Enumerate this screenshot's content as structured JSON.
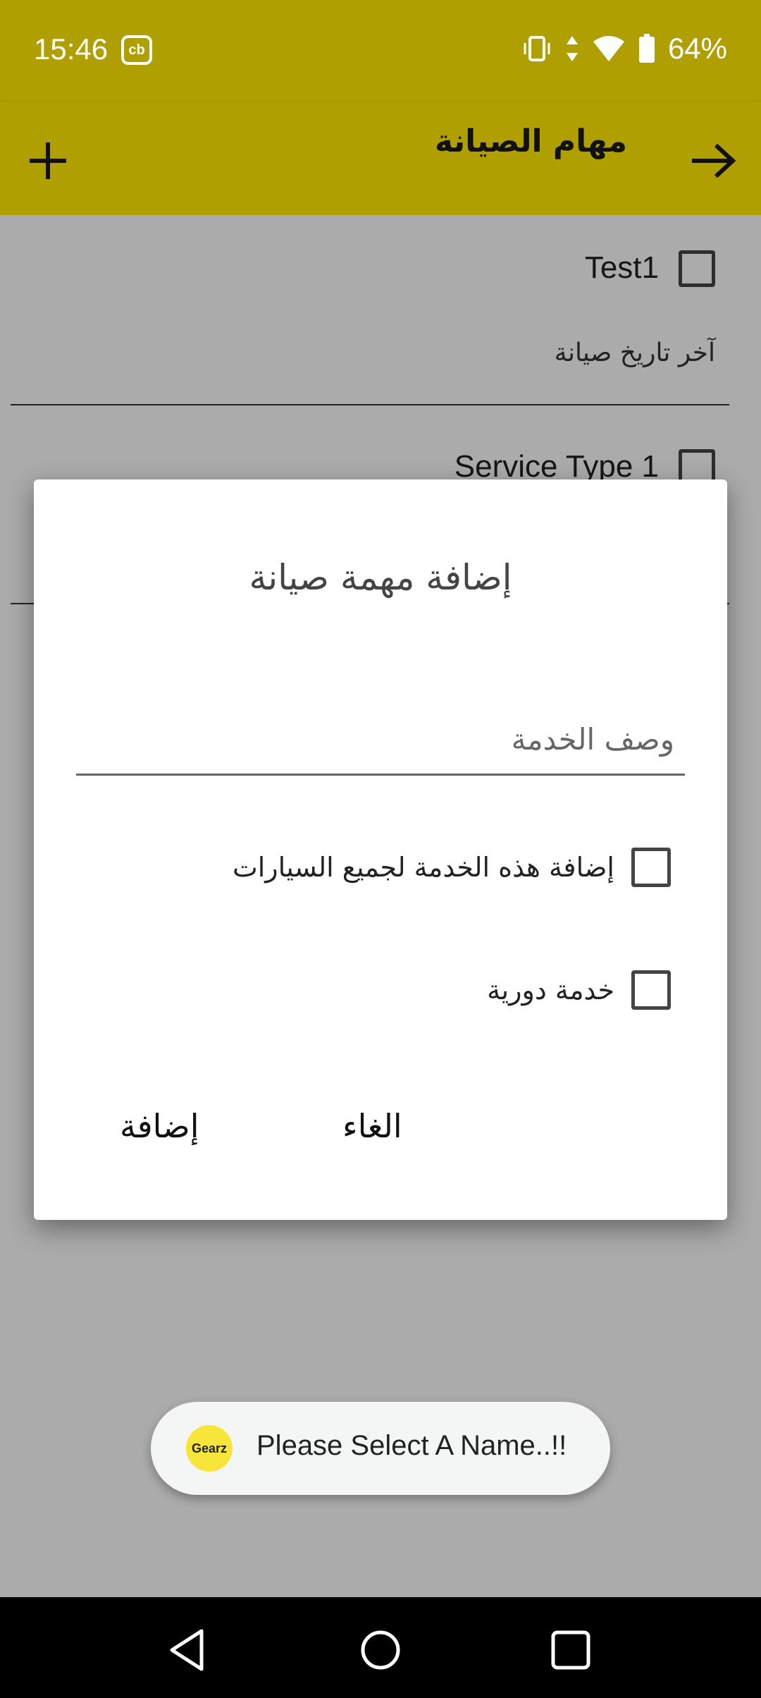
{
  "status_bar": {
    "time": "15:46",
    "notification_icon": "cb",
    "battery": "64%",
    "icons": [
      "vibrate-icon",
      "data-arrows-icon",
      "wifi-icon",
      "battery-icon"
    ]
  },
  "app_bar": {
    "title": "مهام الصيانة",
    "add_icon": "plus-icon",
    "back_icon": "arrow-right-icon"
  },
  "list": {
    "items": [
      {
        "title": "Test1",
        "subtitle": "آخر تاريخ صيانة"
      },
      {
        "title": "Service Type 1",
        "subtitle": ""
      }
    ]
  },
  "dialog": {
    "title": "إضافة مهمة صيانة",
    "input_placeholder": "وصف الخدمة",
    "option_all_cars": "إضافة هذه الخدمة لجميع السيارات",
    "option_periodic": "خدمة دورية",
    "cancel_label": "الغاء",
    "add_label": "إضافة"
  },
  "toast": {
    "logo_text": "Gearz",
    "message": "Please Select A Name..!!"
  },
  "colors": {
    "primary": "#b09f00",
    "scrim": "#a9a9a9",
    "nav_bar": "#000000"
  }
}
